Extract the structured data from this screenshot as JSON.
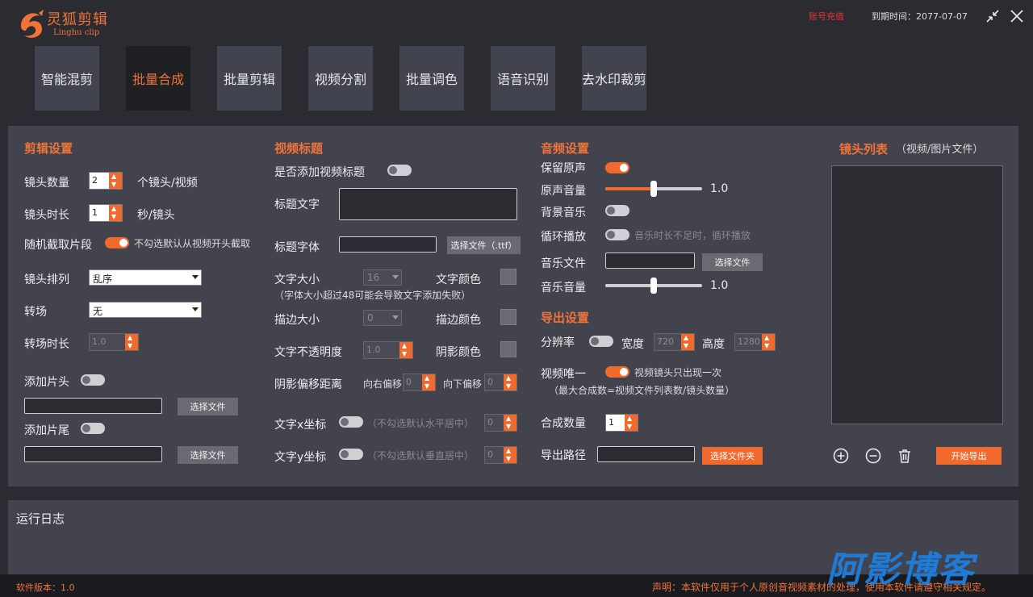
{
  "app": {
    "logo_text": "灵狐剪辑",
    "logo_sub": "Linghu clip",
    "recharge": "账号充值",
    "expire": "到期时间：2077-07-07",
    "icons": [
      "restore-icon",
      "close-icon"
    ]
  },
  "tabs": [
    "智能混剪",
    "批量合成",
    "批量剪辑",
    "视频分割",
    "批量调色",
    "语音识别",
    "去水印裁剪"
  ],
  "active_tab": "批量合成",
  "edit": {
    "heading": "剪辑设置",
    "shot_count_label": "镜头数量",
    "shot_count": "2",
    "shot_count_unit": "个镜头/视频",
    "shot_len_label": "镜头时长",
    "shot_len": "1",
    "shot_len_unit": "秒/镜头",
    "random_label": "随机截取片段",
    "random_on": true,
    "random_note": "不勾选默认从视频开头截取",
    "order_label": "镜头排列",
    "order": "乱序",
    "transition_label": "转场",
    "transition": "无",
    "transition_len_label": "转场时长",
    "transition_len": "1.0",
    "intro_label": "添加片头",
    "intro_on": false,
    "intro_btn": "选择文件",
    "outro_label": "添加片尾",
    "outro_on": false,
    "outro_btn": "选择文件"
  },
  "title": {
    "heading": "视频标题",
    "add_label": "是否添加视频标题",
    "add_on": false,
    "text_label": "标题文字",
    "font_label": "标题字体",
    "font_btn": "选择文件（.ttf）",
    "size_label": "文字大小",
    "size": "16",
    "color_label": "文字颜色",
    "size_note": "（字体大小超过48可能会导致文字添加失败）",
    "stroke_label": "描边大小",
    "stroke": "0",
    "stroke_color_label": "描边颜色",
    "opacity_label": "文字不透明度",
    "opacity": "1.0",
    "shadow_color_label": "阴影颜色",
    "shadow_label": "阴影偏移距离",
    "shadow_right_label": "向右偏移",
    "shadow_right": "0",
    "shadow_down_label": "向下偏移",
    "shadow_down": "0",
    "x_label": "文字x坐标",
    "x_on": false,
    "x_hint": "（不勾选默认水平居中）",
    "x": "0",
    "y_label": "文字y坐标",
    "y_on": false,
    "y_hint": "（不勾选默认垂直居中）",
    "y": "0"
  },
  "audio": {
    "heading": "音频设置",
    "keep_label": "保留原声",
    "keep_on": true,
    "orig_vol_label": "原声音量",
    "orig_vol": "1.0",
    "orig_vol_fraction": 0.5,
    "bgm_label": "背景音乐",
    "bgm_on": false,
    "loop_label": "循环播放",
    "loop_on": false,
    "loop_hint": "音乐时长不足时，循环播放",
    "file_label": "音乐文件",
    "file_btn": "选择文件",
    "music_vol_label": "音乐音量",
    "music_vol": "1.0",
    "music_vol_fraction": 0.5
  },
  "export": {
    "heading": "导出设置",
    "res_label": "分辨率",
    "res_on": false,
    "width_label": "宽度",
    "width": "720",
    "height_label": "高度",
    "height": "1280",
    "unique_label": "视频唯一",
    "unique_on": true,
    "unique_note": "视频镜头只出现一次",
    "max_note": "（最大合成数=视频文件列表数/镜头数量）",
    "count_label": "合成数量",
    "count": "1",
    "path_label": "导出路径",
    "path_btn": "选择文件夹"
  },
  "shots": {
    "heading": "镜头列表",
    "sub": "（视频/图片文件）",
    "start_btn": "开始导出",
    "icons": [
      "add-circle-icon",
      "remove-circle-icon",
      "trash-icon"
    ]
  },
  "log": {
    "title": "运行日志"
  },
  "footer": {
    "version": "软件版本：1.0",
    "declaration": "声明：本软件仅用于个人原创音视频素材的处理，使用本软件请遵守相关规定。"
  },
  "watermark": "阿影博客",
  "colors": {
    "accent": "#f06a2e",
    "bg": "#2b2c31",
    "panel": "#42434d",
    "recharge": "#e5322d"
  }
}
